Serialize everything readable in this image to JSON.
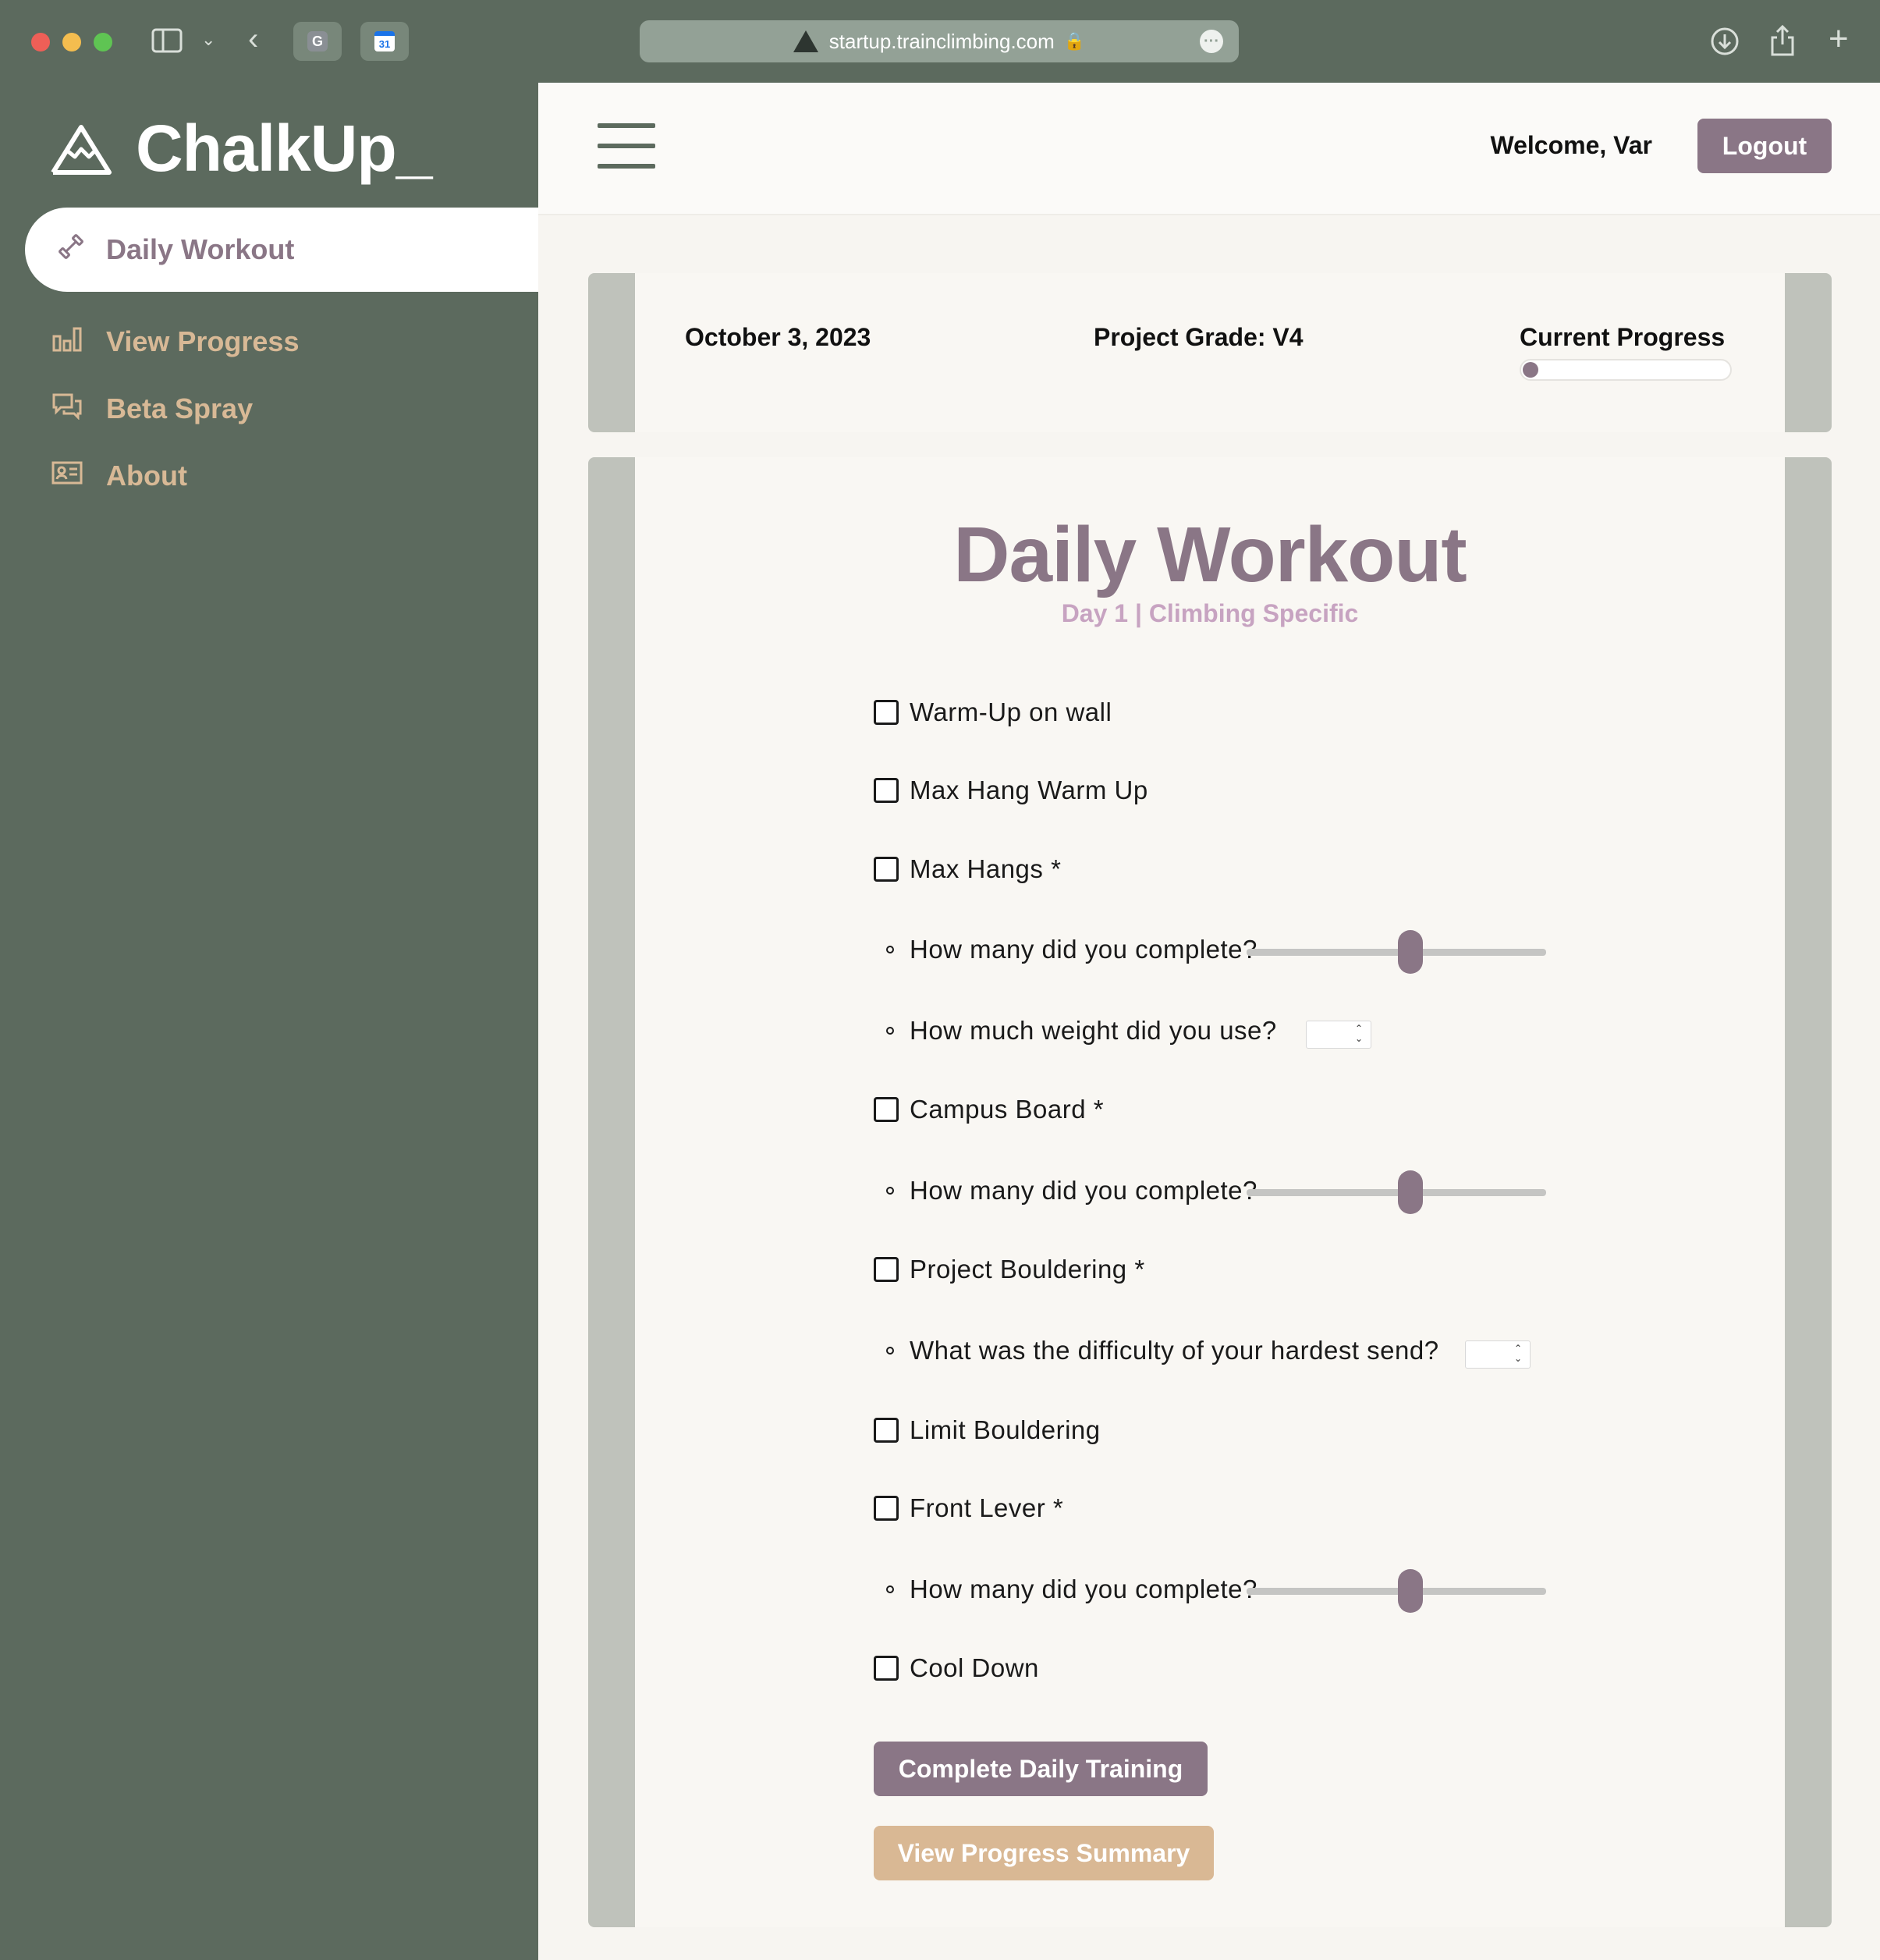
{
  "browser": {
    "url": "startup.trainclimbing.com",
    "tab1_icon": "G",
    "tab2_icon": "31"
  },
  "sidebar": {
    "brand": "ChalkUp_",
    "items": [
      {
        "label": "Daily Workout",
        "icon": "dumbbell-icon",
        "active": true
      },
      {
        "label": "View Progress",
        "icon": "bar-chart-icon",
        "active": false
      },
      {
        "label": "Beta Spray",
        "icon": "chat-bubbles-icon",
        "active": false
      },
      {
        "label": "About",
        "icon": "id-card-icon",
        "active": false
      }
    ]
  },
  "header": {
    "welcome": "Welcome, Var",
    "logout": "Logout"
  },
  "status": {
    "date": "October 3, 2023",
    "grade": "Project Grade: V4",
    "progress_label": "Current Progress",
    "progress_value": 0
  },
  "workout": {
    "title": "Daily Workout",
    "subtitle": "Day 1 | Climbing Specific",
    "tasks": [
      {
        "label": "Warm-Up on wall",
        "checked": false
      },
      {
        "label": "Max Hang Warm Up",
        "checked": false
      },
      {
        "label": "Max Hangs *",
        "checked": false
      },
      {
        "label": "Campus Board *",
        "checked": false
      },
      {
        "label": "Project Bouldering *",
        "checked": false
      },
      {
        "label": "Limit Bouldering",
        "checked": false
      },
      {
        "label": "Front Lever *",
        "checked": false
      },
      {
        "label": "Cool Down",
        "checked": false
      }
    ],
    "questions": {
      "maxhangs_count": {
        "label": "How many did you complete?",
        "slider_value": 0.55
      },
      "maxhangs_weight": {
        "label": "How much weight did you use?",
        "value": ""
      },
      "campus_count": {
        "label": "How many did you complete?",
        "slider_value": 0.55
      },
      "project_difficulty": {
        "label": "What was the difficulty of your hardest send?",
        "value": ""
      },
      "frontlever_count": {
        "label": "How many did you complete?",
        "slider_value": 0.55
      }
    },
    "complete_button": "Complete Daily Training",
    "summary_button": "View Progress Summary"
  },
  "colors": {
    "sidebar_bg": "#5c6a5e",
    "accent_mauve": "#8a7686",
    "accent_tan": "#d9b894",
    "subtitle_pink": "#c7a3c1"
  }
}
